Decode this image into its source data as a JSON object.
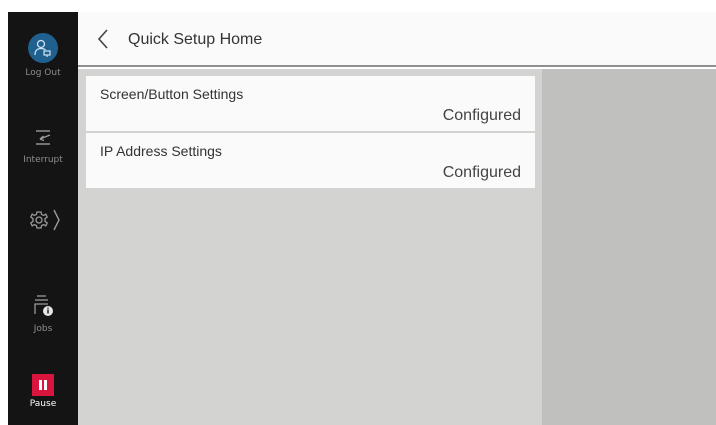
{
  "sidebar": {
    "logout_label": "Log Out",
    "interrupt_label": "Interrupt",
    "jobs_label": "Jobs",
    "pause_label": "Pause"
  },
  "header": {
    "title": "Quick Setup Home"
  },
  "settings": [
    {
      "title": "Screen/Button Settings",
      "status": "Configured"
    },
    {
      "title": "IP Address Settings",
      "status": "Configured"
    }
  ],
  "colors": {
    "sidebar_bg": "#141414",
    "avatar_blue": "#20608f",
    "pause_red": "#d9143d",
    "content_bg": "#d3d3d1",
    "right_pane_bg": "#c0c0be"
  }
}
